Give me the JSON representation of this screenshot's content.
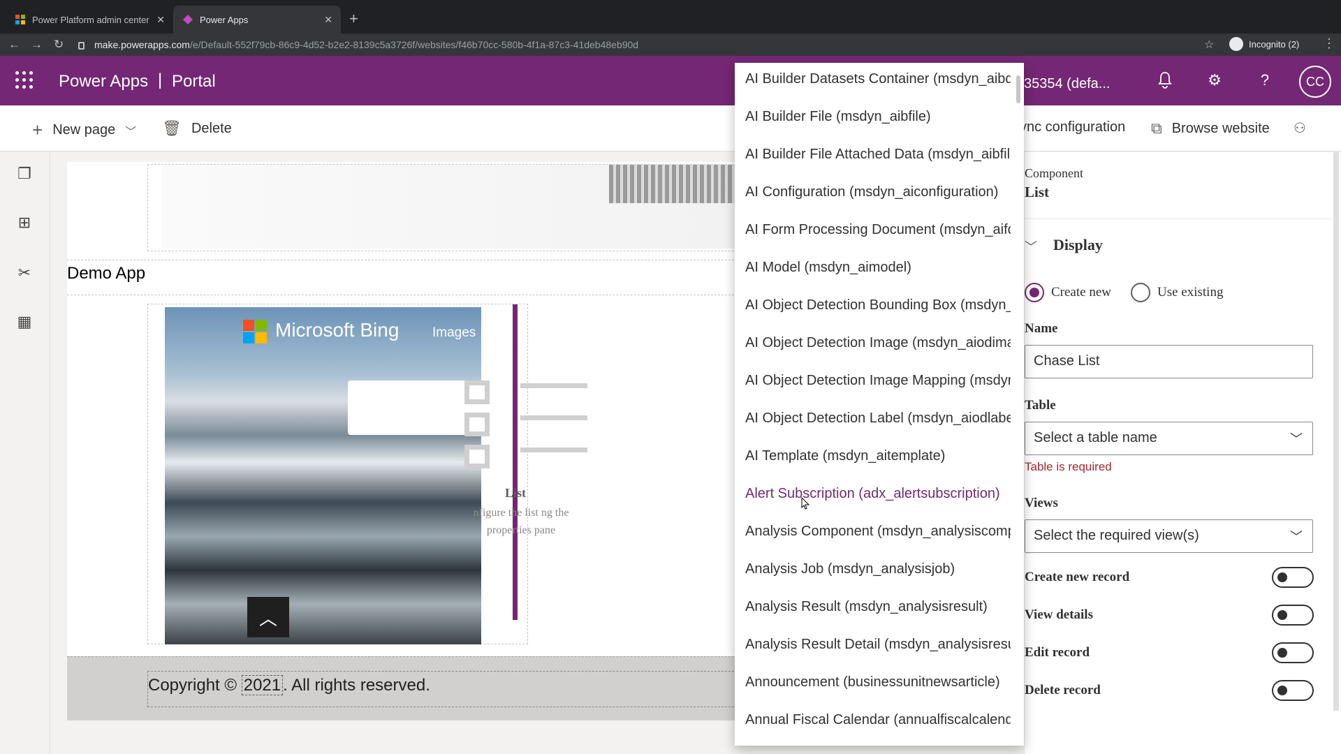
{
  "browser": {
    "tabs": [
      {
        "label": "Power Platform admin center",
        "active": false
      },
      {
        "label": "Power Apps",
        "active": true
      }
    ],
    "url_host": "make.powerapps.com",
    "url_path": "/e/Default-552f79cb-86c9-4d52-b2e2-8139c5a3726f/websites/f46b70cc-580b-4f1a-87c3-41deb48eb90d",
    "profile_label": "Incognito (2)"
  },
  "app": {
    "title": "Power Apps",
    "separator": "|",
    "section": "Portal",
    "environment": "35354 (defa...",
    "avatar": "CC",
    "accent": "#742774"
  },
  "toolbar": {
    "new_page": "New page",
    "delete": "Delete",
    "sync": "ync configuration",
    "browse": "Browse website"
  },
  "canvas": {
    "site_title": "Demo App",
    "bing_brand": "Microsoft Bing",
    "bing_images": "Images",
    "list_label": "List",
    "list_desc": "nfigure the list ng the properties pane",
    "copyright_prefix": "Copyright © ",
    "copyright_year": "2021",
    "copyright_suffix": ". All rights reserved."
  },
  "dropdown": {
    "items": [
      "AI Builder Datasets Container (msdyn_aibdatasetscontainer)",
      "AI Builder File (msdyn_aibfile)",
      "AI Builder File Attached Data (msdyn_aibfileattacheddata)",
      "AI Configuration (msdyn_aiconfiguration)",
      "AI Form Processing Document (msdyn_aiformprocessingdocument)",
      "AI Model (msdyn_aimodel)",
      "AI Object Detection Bounding Box (msdyn_aiodboundingbox)",
      "AI Object Detection Image (msdyn_aiodimage)",
      "AI Object Detection Image Mapping (msdyn_aiodimagemapping)",
      "AI Object Detection Label (msdyn_aiodlabel)",
      "AI Template (msdyn_aitemplate)",
      "Alert Subscription (adx_alertsubscription)",
      "Analysis Component (msdyn_analysiscomponent)",
      "Analysis Job (msdyn_analysisjob)",
      "Analysis Result (msdyn_analysisresult)",
      "Analysis Result Detail (msdyn_analysisresultdetail)",
      "Announcement (businessunitnewsarticle)",
      "Annual Fiscal Calendar (annualfiscalcalendar)"
    ],
    "hovered": "Alert Subscription (adx_alertsubscription)"
  },
  "panel": {
    "component_caption": "Component",
    "component_name": "List",
    "section": "Display",
    "radio_create": "Create new",
    "radio_existing": "Use existing",
    "name_label": "Name",
    "name_value": "Chase List",
    "table_label": "Table",
    "table_placeholder": "Select a table name",
    "table_error": "Table is required",
    "views_label": "Views",
    "views_placeholder": "Select the required view(s)",
    "toggles": [
      "Create new record",
      "View details",
      "Edit record",
      "Delete record"
    ]
  }
}
